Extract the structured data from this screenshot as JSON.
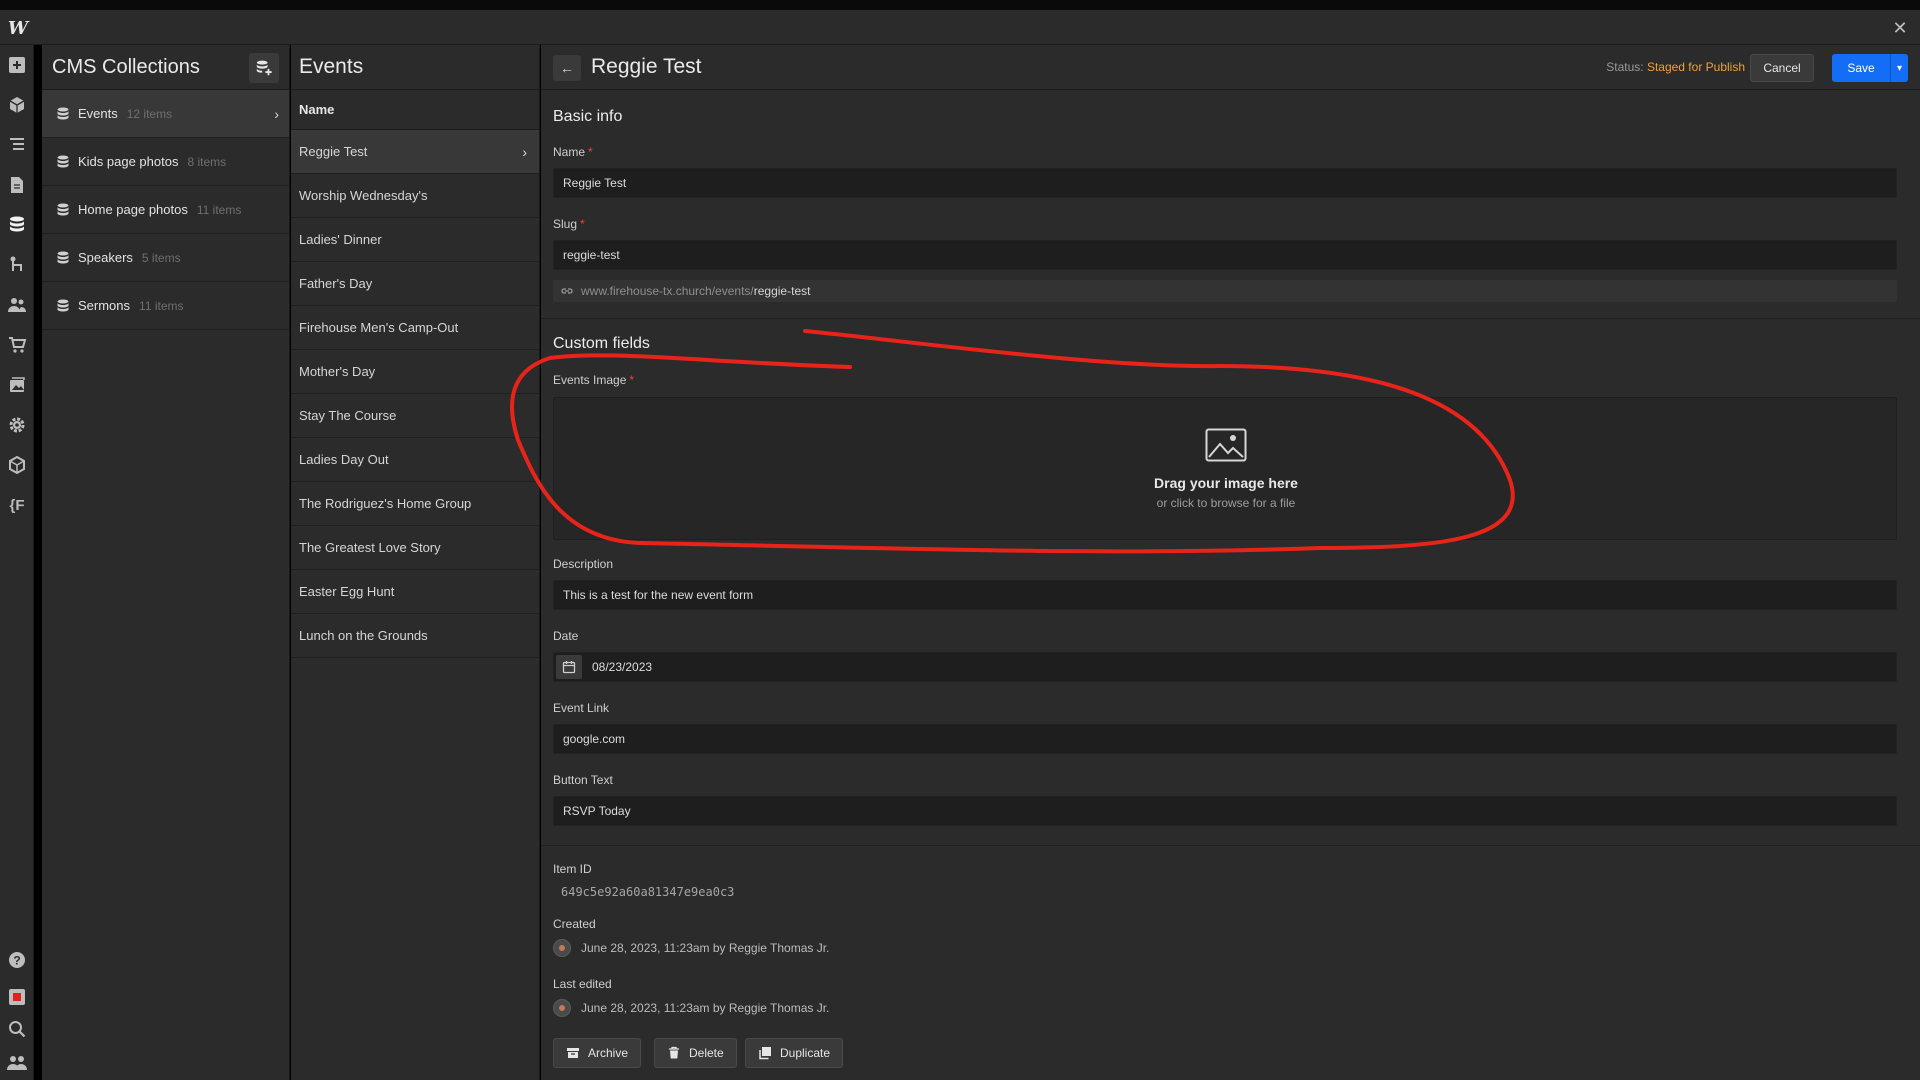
{
  "app": {
    "logo": "W",
    "close": "✕"
  },
  "collections_panel": {
    "title": "CMS Collections",
    "items": [
      {
        "name": "Events",
        "count": "12 items",
        "active": true
      },
      {
        "name": "Kids page photos",
        "count": "8 items"
      },
      {
        "name": "Home page photos",
        "count": "11 items"
      },
      {
        "name": "Speakers",
        "count": "5 items"
      },
      {
        "name": "Sermons",
        "count": "11 items"
      }
    ]
  },
  "items_panel": {
    "title": "Events",
    "column_header": "Name",
    "items": [
      "Reggie Test",
      "Worship Wednesday's",
      "Ladies' Dinner",
      "Father's Day",
      "Firehouse Men's Camp-Out",
      "Mother's Day",
      "Stay The Course",
      "Ladies Day Out",
      "The Rodriguez's Home Group",
      "The Greatest Love Story",
      "Easter Egg Hunt",
      "Lunch on the Grounds"
    ]
  },
  "editor": {
    "title": "Reggie Test",
    "status_label": "Status:",
    "status_value": "Staged for Publish",
    "cancel_label": "Cancel",
    "save_label": "Save",
    "basic_info_title": "Basic info",
    "name_label": "Name",
    "name_value": "Reggie Test",
    "slug_label": "Slug",
    "slug_value": "reggie-test",
    "url_prefix": "www.firehouse-tx.church/events/",
    "url_slug": "reggie-test",
    "custom_fields_title": "Custom fields",
    "image_label": "Events Image",
    "dropzone_title": "Drag your image here",
    "dropzone_sub": "or click to browse for a file",
    "description_label": "Description",
    "description_value": "This is a test for the new event form",
    "date_label": "Date",
    "date_value": "08/23/2023",
    "link_label": "Event Link",
    "link_value": "google.com",
    "button_text_label": "Button Text",
    "button_text_value": "RSVP Today",
    "item_id_label": "Item ID",
    "item_id_value": "649c5e92a60a81347e9ea0c3",
    "created_label": "Created",
    "created_value": "June 28, 2023, 11:23am by Reggie Thomas Jr.",
    "last_edited_label": "Last edited",
    "last_edited_value": "June 28, 2023, 11:23am by Reggie Thomas Jr.",
    "archive_label": "Archive",
    "delete_label": "Delete",
    "duplicate_label": "Duplicate"
  },
  "colors": {
    "accent": "#146ef5",
    "status": "#f0a035",
    "required": "#e8453c",
    "annotation": "#e8241a"
  },
  "icons": {
    "left_toolbar": [
      "add-icon",
      "components-icon",
      "navigator-icon",
      "pages-icon",
      "cms-icon",
      "logic-icon",
      "users-icon",
      "ecommerce-icon",
      "assets-icon",
      "settings-icon",
      "apps-icon",
      "variables-icon",
      "help-icon",
      "video-icon",
      "search-icon",
      "collaborators-icon"
    ]
  }
}
